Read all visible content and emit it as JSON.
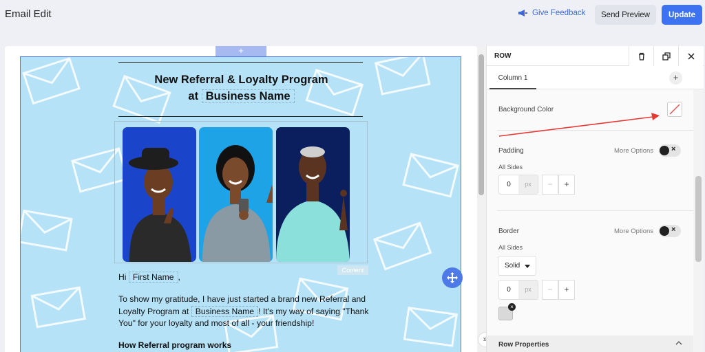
{
  "header": {
    "title": "Email Edit",
    "give_feedback": "Give Feedback",
    "send_preview": "Send Preview",
    "update": "Update"
  },
  "canvas": {
    "add_row": "+",
    "title_line1": "New Referral & Loyalty Program",
    "title_at": "at",
    "title_merge": "Business Name",
    "content_tag": "Content",
    "greeting_hi": "Hi",
    "greeting_merge": "First Name",
    "greeting_comma": ",",
    "para_part1": "To show my gratitude, I have just started a brand new Referral and Loyalty Program at",
    "para_merge": "Business Name",
    "para_part2": "! It's my way of saying \"Thank You\" for your loyalty and most of all - your friendship!",
    "how_heading": "How Referral program works",
    "collapse": "»",
    "colors": {
      "background": "#b5e2f6",
      "selection": "#4d7ae6",
      "panel_left": "#1a44c9",
      "panel_middle": "#1ea3e6",
      "panel_right": "#0b1f5e"
    }
  },
  "panel": {
    "title": "ROW",
    "tab": "Column 1",
    "tab_add": "+",
    "background_color_label": "Background Color",
    "padding_label": "Padding",
    "padding_more": "More Options",
    "padding_sides": "All Sides",
    "padding_value": "0",
    "padding_unit": "px",
    "border_label": "Border",
    "border_more": "More Options",
    "border_sides": "All Sides",
    "border_style": "Solid",
    "border_value": "0",
    "border_unit": "px",
    "minus": "−",
    "plus": "+",
    "row_properties": "Row Properties",
    "icons": [
      "trash-icon",
      "duplicate-icon",
      "close-icon"
    ]
  }
}
